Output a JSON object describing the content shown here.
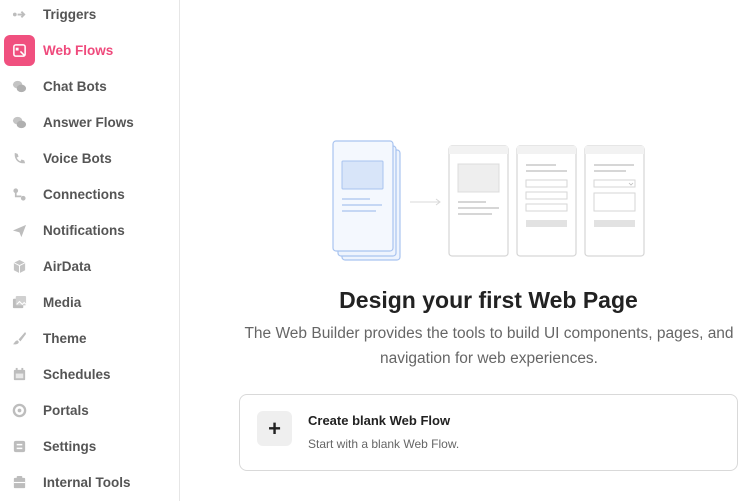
{
  "sidebar": {
    "items": [
      {
        "label": "Triggers",
        "icon": "triggers-icon",
        "active": false
      },
      {
        "label": "Web Flows",
        "icon": "web-flows-icon",
        "active": true
      },
      {
        "label": "Chat Bots",
        "icon": "chat-bubbles-icon",
        "active": false
      },
      {
        "label": "Answer Flows",
        "icon": "answer-bubbles-icon",
        "active": false
      },
      {
        "label": "Voice Bots",
        "icon": "phone-icon",
        "active": false
      },
      {
        "label": "Connections",
        "icon": "connections-icon",
        "active": false
      },
      {
        "label": "Notifications",
        "icon": "paper-plane-icon",
        "active": false
      },
      {
        "label": "AirData",
        "icon": "cube-icon",
        "active": false
      },
      {
        "label": "Media",
        "icon": "media-icon",
        "active": false
      },
      {
        "label": "Theme",
        "icon": "brush-icon",
        "active": false
      },
      {
        "label": "Schedules",
        "icon": "calendar-icon",
        "active": false
      },
      {
        "label": "Portals",
        "icon": "portal-icon",
        "active": false
      },
      {
        "label": "Settings",
        "icon": "settings-icon",
        "active": false
      },
      {
        "label": "Internal Tools",
        "icon": "internal-tools-icon",
        "active": false
      }
    ]
  },
  "main": {
    "title": "Design your first Web Page",
    "subtitle": "The Web Builder provides the tools to build UI components, pages, and navigation for web experiences.",
    "create_card": {
      "icon": "plus-icon",
      "title": "Create blank Web Flow",
      "description": "Start with a blank Web Flow."
    }
  },
  "colors": {
    "accent": "#ef4a7c",
    "illustration_blue": "#a9c4f0",
    "illustration_fill": "#eef4fd"
  }
}
